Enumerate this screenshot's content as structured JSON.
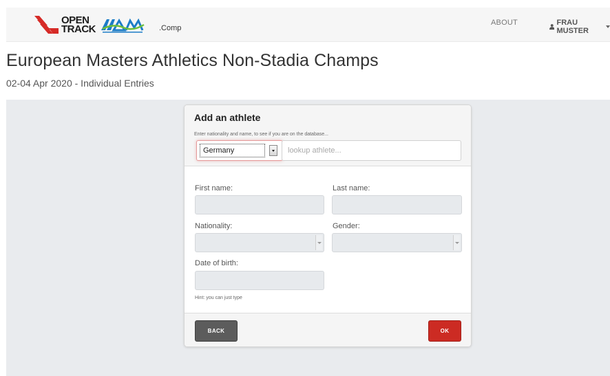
{
  "navbar": {
    "logo_line1": "OPEN",
    "logo_line2": "TRACK",
    "comp_label": ".Comp",
    "about_label": "ABOUT",
    "user_label": "FRAU MUSTER"
  },
  "page": {
    "title": "European Masters Athletics Non-Stadia Champs",
    "subtitle": "02-04 Apr 2020 - Individual Entries"
  },
  "dialog": {
    "title": "Add an athlete",
    "lookup_hint": "Enter nationality and name, to see if you are on the database...",
    "country_value": "Germany",
    "lookup_placeholder": "lookup athlete...",
    "first_name_label": "First name:",
    "last_name_label": "Last name:",
    "nationality_label": "Nationality:",
    "gender_label": "Gender:",
    "dob_label": "Date of birth:",
    "dob_hint": "Hint: you can just type",
    "back_label": "BACK",
    "ok_label": "OK"
  },
  "colors": {
    "ok_button": "#cc2b23",
    "back_button": "#5c5c5c",
    "logo_red": "#d62b27",
    "emma_blue": "#1c7cc7",
    "emma_green": "#6dbf3b"
  }
}
